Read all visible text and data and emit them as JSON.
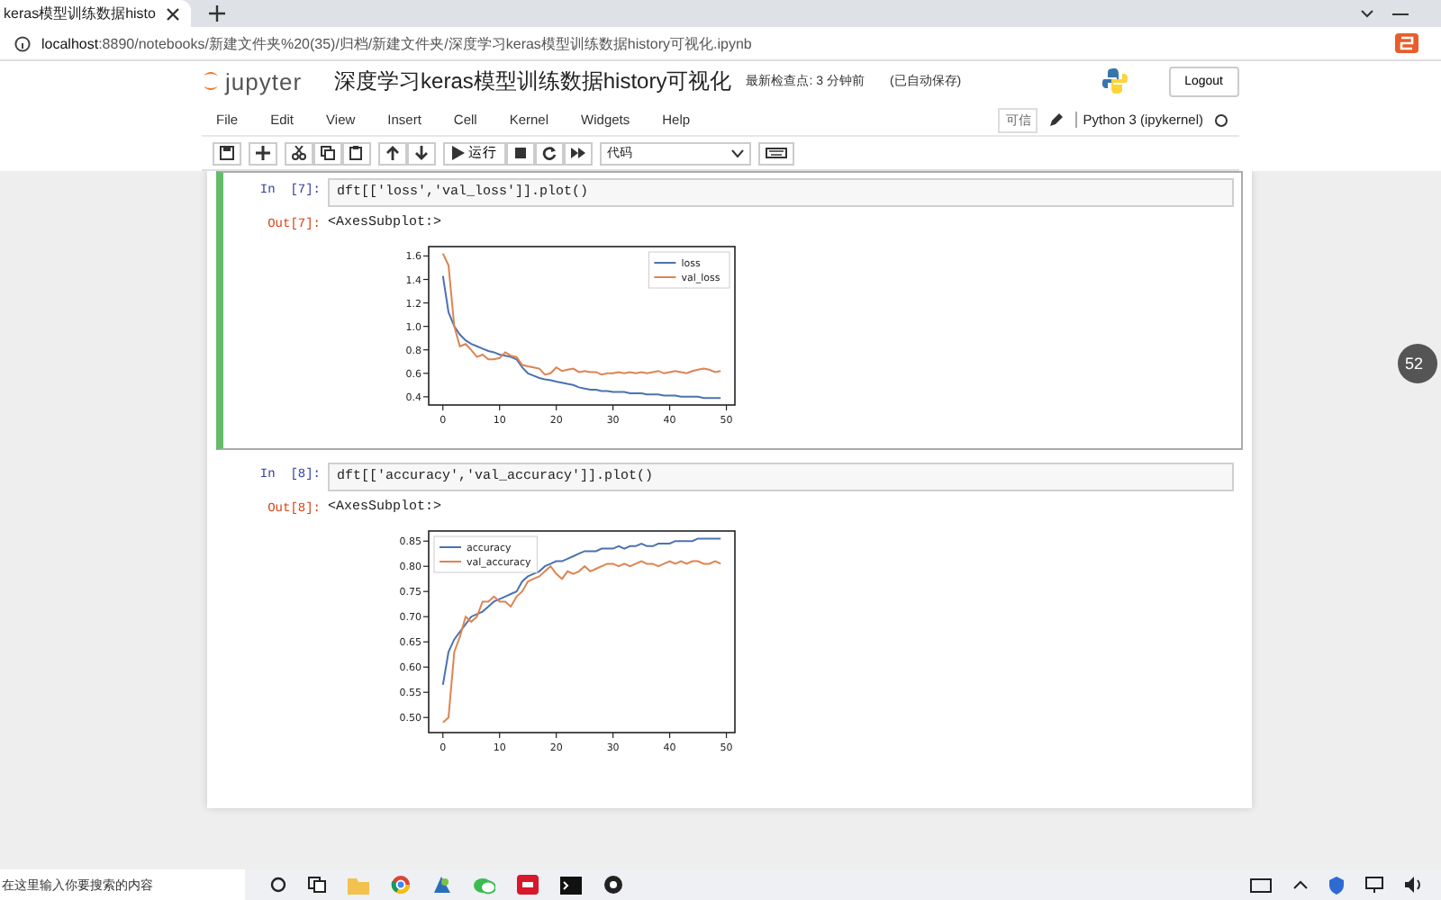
{
  "browser": {
    "tab_title": "keras模型训练数据histo",
    "url_host": "localhost",
    "url_rest": ":8890/notebooks/新建文件夹%20(35)/归档/新建文件夹/深度学习keras模型训练数据history可视化.ipynb"
  },
  "header": {
    "logo_text": "jupyter",
    "notebook_title": "深度学习keras模型训练数据history可视化",
    "checkpoint": "最新检查点: 3 分钟前",
    "autosave": "(已自动保存)",
    "logout": "Logout"
  },
  "menubar": {
    "items": [
      "File",
      "Edit",
      "View",
      "Insert",
      "Cell",
      "Kernel",
      "Widgets",
      "Help"
    ],
    "trusted": "可信",
    "kernel": "Python 3 (ipykernel)"
  },
  "toolbar": {
    "run_label": "运行",
    "cell_type": "代码"
  },
  "cells": [
    {
      "prompt": "In  [7]:",
      "code": "dft[['loss','val_loss']].plot()",
      "selected": true,
      "out_prompt": "Out[7]:",
      "output_text": "<AxesSubplot:>",
      "chart_data": {
        "type": "line",
        "x": [
          0,
          1,
          2,
          3,
          4,
          5,
          6,
          7,
          8,
          9,
          10,
          11,
          12,
          13,
          14,
          15,
          16,
          17,
          18,
          19,
          20,
          21,
          22,
          23,
          24,
          25,
          26,
          27,
          28,
          29,
          30,
          31,
          32,
          33,
          34,
          35,
          36,
          37,
          38,
          39,
          40,
          41,
          42,
          43,
          44,
          45,
          46,
          47,
          48,
          49
        ],
        "xlim": [
          -2.5,
          51.5
        ],
        "ylim": [
          0.33,
          1.68
        ],
        "xticks": [
          0,
          10,
          20,
          30,
          40,
          50
        ],
        "yticks": [
          0.4,
          0.6,
          0.8,
          {
            "value": 1,
            "label": "1.0"
          },
          1.2,
          1.4,
          1.6
        ],
        "legend": "upper right",
        "series": [
          {
            "name": "loss",
            "color": "#4c72b0",
            "values": [
              1.43,
              1.12,
              1.0,
              0.93,
              0.88,
              0.85,
              0.83,
              0.81,
              0.79,
              0.78,
              0.76,
              0.75,
              0.74,
              0.72,
              0.65,
              0.6,
              0.58,
              0.56,
              0.55,
              0.54,
              0.53,
              0.52,
              0.51,
              0.5,
              0.48,
              0.47,
              0.46,
              0.46,
              0.45,
              0.45,
              0.44,
              0.44,
              0.44,
              0.43,
              0.43,
              0.43,
              0.42,
              0.42,
              0.42,
              0.41,
              0.41,
              0.41,
              0.4,
              0.4,
              0.4,
              0.4,
              0.39,
              0.39,
              0.39,
              0.39
            ]
          },
          {
            "name": "val_loss",
            "color": "#dd8452",
            "values": [
              1.62,
              1.52,
              1.0,
              0.83,
              0.85,
              0.8,
              0.74,
              0.76,
              0.72,
              0.72,
              0.73,
              0.78,
              0.75,
              0.74,
              0.67,
              0.66,
              0.65,
              0.64,
              0.59,
              0.6,
              0.65,
              0.62,
              0.63,
              0.64,
              0.61,
              0.62,
              0.61,
              0.61,
              0.59,
              0.6,
              0.6,
              0.61,
              0.6,
              0.61,
              0.6,
              0.61,
              0.6,
              0.61,
              0.62,
              0.6,
              0.61,
              0.62,
              0.61,
              0.6,
              0.62,
              0.63,
              0.64,
              0.63,
              0.61,
              0.62
            ]
          }
        ]
      }
    },
    {
      "prompt": "In  [8]:",
      "code": "dft[['accuracy','val_accuracy']].plot()",
      "selected": false,
      "out_prompt": "Out[8]:",
      "output_text": "<AxesSubplot:>",
      "chart_data": {
        "type": "line",
        "x": [
          0,
          1,
          2,
          3,
          4,
          5,
          6,
          7,
          8,
          9,
          10,
          11,
          12,
          13,
          14,
          15,
          16,
          17,
          18,
          19,
          20,
          21,
          22,
          23,
          24,
          25,
          26,
          27,
          28,
          29,
          30,
          31,
          32,
          33,
          34,
          35,
          36,
          37,
          38,
          39,
          40,
          41,
          42,
          43,
          44,
          45,
          46,
          47,
          48,
          49
        ],
        "xlim": [
          -2.5,
          51.5
        ],
        "ylim": [
          0.47,
          0.87
        ],
        "xticks": [
          0,
          10,
          20,
          30,
          40,
          50
        ],
        "yticks": [
          {
            "value": 0.5,
            "label": "0.50"
          },
          0.55,
          {
            "value": 0.6,
            "label": "0.60"
          },
          0.65,
          {
            "value": 0.7,
            "label": "0.70"
          },
          0.75,
          {
            "value": 0.8,
            "label": "0.80"
          },
          0.85
        ],
        "legend": "upper left",
        "series": [
          {
            "name": "accuracy",
            "color": "#4c72b0",
            "values": [
              0.565,
              0.63,
              0.655,
              0.67,
              0.685,
              0.7,
              0.705,
              0.71,
              0.72,
              0.73,
              0.735,
              0.74,
              0.745,
              0.75,
              0.77,
              0.78,
              0.785,
              0.79,
              0.8,
              0.805,
              0.81,
              0.81,
              0.815,
              0.82,
              0.825,
              0.83,
              0.83,
              0.83,
              0.835,
              0.835,
              0.835,
              0.84,
              0.835,
              0.84,
              0.84,
              0.845,
              0.84,
              0.84,
              0.845,
              0.845,
              0.845,
              0.85,
              0.85,
              0.85,
              0.85,
              0.855,
              0.855,
              0.855,
              0.855,
              0.855
            ]
          },
          {
            "name": "val_accuracy",
            "color": "#dd8452",
            "values": [
              0.49,
              0.5,
              0.63,
              0.66,
              0.7,
              0.69,
              0.7,
              0.73,
              0.73,
              0.74,
              0.73,
              0.73,
              0.72,
              0.74,
              0.75,
              0.77,
              0.775,
              0.78,
              0.79,
              0.8,
              0.785,
              0.775,
              0.79,
              0.785,
              0.79,
              0.8,
              0.79,
              0.795,
              0.8,
              0.805,
              0.805,
              0.8,
              0.805,
              0.8,
              0.805,
              0.81,
              0.805,
              0.805,
              0.8,
              0.805,
              0.81,
              0.805,
              0.81,
              0.805,
              0.81,
              0.81,
              0.805,
              0.805,
              0.81,
              0.805
            ]
          }
        ]
      }
    }
  ],
  "side_badge": "52",
  "taskbar": {
    "search_placeholder": "在这里输入你要搜索的内容"
  }
}
